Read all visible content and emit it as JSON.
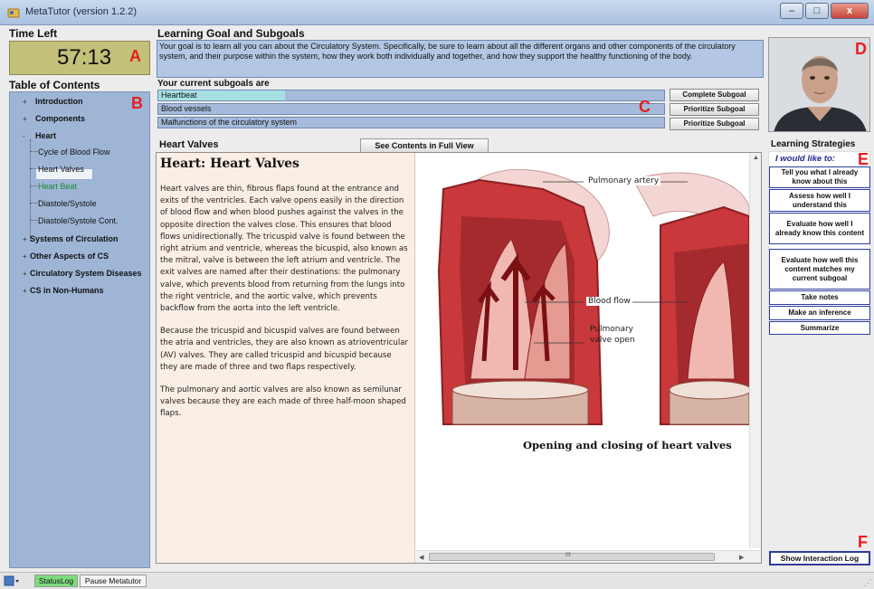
{
  "window": {
    "title": "MetaTutor (version 1.2.2)",
    "minimize": "–",
    "maximize": "□",
    "close": "x"
  },
  "timer": {
    "heading": "Time Left",
    "value": "57:13"
  },
  "markers": {
    "a": "A",
    "b": "B",
    "c": "C",
    "d": "D",
    "e": "E",
    "f": "F"
  },
  "toc": {
    "heading": "Table of Contents",
    "items": [
      {
        "label": "Introduction",
        "expander": "+"
      },
      {
        "label": "Components",
        "expander": "+"
      },
      {
        "label": "Heart",
        "expander": "-"
      },
      {
        "label": "Cycle of Blood Flow"
      },
      {
        "label": "Heart Valves",
        "selected": true
      },
      {
        "label": "Heart Beat",
        "current": true
      },
      {
        "label": "Diastole/Systole"
      },
      {
        "label": "Diastole/Systole Cont."
      },
      {
        "label": "Systems of Circulation",
        "expander": "+"
      },
      {
        "label": "Other Aspects of CS",
        "expander": "+"
      },
      {
        "label": "Circulatory System Diseases",
        "expander": "+"
      },
      {
        "label": "CS in Non-Humans",
        "expander": "+"
      }
    ]
  },
  "goal": {
    "heading": "Learning Goal and Subgoals",
    "text": "Your goal is to learn all you can about the Circulatory System. Specifically, be sure to learn about all the different organs and other components of the circulatory system, and their purpose within the system, how they work both individually and together, and how they support the healthy functioning of the body."
  },
  "subgoals": {
    "heading": "Your current subgoals are",
    "items": [
      {
        "label": "Heartbeat",
        "button": "Complete Subgoal"
      },
      {
        "label": "Blood vessels",
        "button": "Prioritize Subgoal"
      },
      {
        "label": "Malfunctions of the circulatory system",
        "button": "Prioritize Subgoal"
      }
    ]
  },
  "content": {
    "heading": "Heart Valves",
    "full_view_button": "See Contents in Full View",
    "article_title": "Heart: Heart Valves",
    "paragraphs": [
      "Heart valves are thin, fibrous flaps found at the entrance and exits of the ventricles. Each valve opens easily in the direction of blood flow and when blood pushes against the valves in the opposite direction the valves close. This ensures that blood flows unidirectionally. The tricuspid valve is found between the right atrium and ventricle, whereas the bicuspid, also known as the mitral, valve is between the left atrium and ventricle. The exit valves are named after their destinations: the pulmonary valve, which prevents blood from returning from the lungs into the right ventricle, and the aortic valve, which prevents backflow from the aorta into the left ventricle.",
      "Because the tricuspid and bicuspid valves are found between the atria and ventricles, they are also known as atrioventricular (AV) valves. They are called tricuspid and bicuspid because they are made of three and two flaps respectively.",
      "The pulmonary and aortic valves are also known as semilunar valves because they are each made of three half-moon shaped flaps."
    ],
    "image": {
      "label_pulmonary_artery": "Pulmonary artery",
      "label_blood_flow": "Blood flow",
      "label_valve_open_1": "Pulmonary",
      "label_valve_open_2": "valve open",
      "caption": "Opening and closing of heart valves"
    },
    "scroll_thumb_label": "III"
  },
  "strategies": {
    "heading": "Learning Strategies",
    "prompt": "I would like to:",
    "buttons": [
      "Tell you what I already know about this",
      "Assess how well I understand this",
      "Evaluate how well I already know this content",
      "Evaluate how well this content matches my current subgoal",
      "Take notes",
      "Make an inference",
      "Summarize"
    ],
    "log_button": "Show Interaction Log"
  },
  "statusbar": {
    "status_tab": "StatusLog",
    "pause_tab": "Pause Metatutor"
  },
  "colors": {
    "accent": "#2f3c9a",
    "toc_bg": "#9fb5d6",
    "timer_bg": "#c3c07a",
    "marker": "#e62020"
  }
}
